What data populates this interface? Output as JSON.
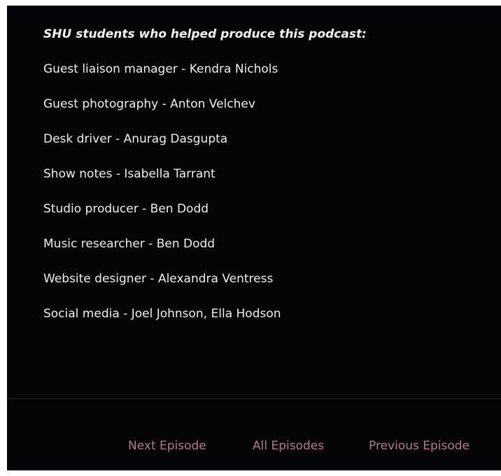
{
  "credits": {
    "heading": "SHU students who helped produce this podcast:",
    "lines": [
      "Guest liaison manager - Kendra Nichols",
      "Guest photography - Anton Velchev",
      "Desk driver - Anurag Dasgupta",
      "Show notes - Isabella Tarrant",
      "Studio producer - Ben Dodd",
      "Music researcher - Ben Dodd",
      "Website designer - Alexandra Ventress",
      "Social media - Joel Johnson, Ella Hodson"
    ]
  },
  "episode_nav": {
    "next": "Next Episode",
    "all": "All Episodes",
    "previous": "Previous Episode"
  },
  "colors": {
    "background": "#050406",
    "text": "#f0eef0",
    "link": "#b07a91"
  }
}
